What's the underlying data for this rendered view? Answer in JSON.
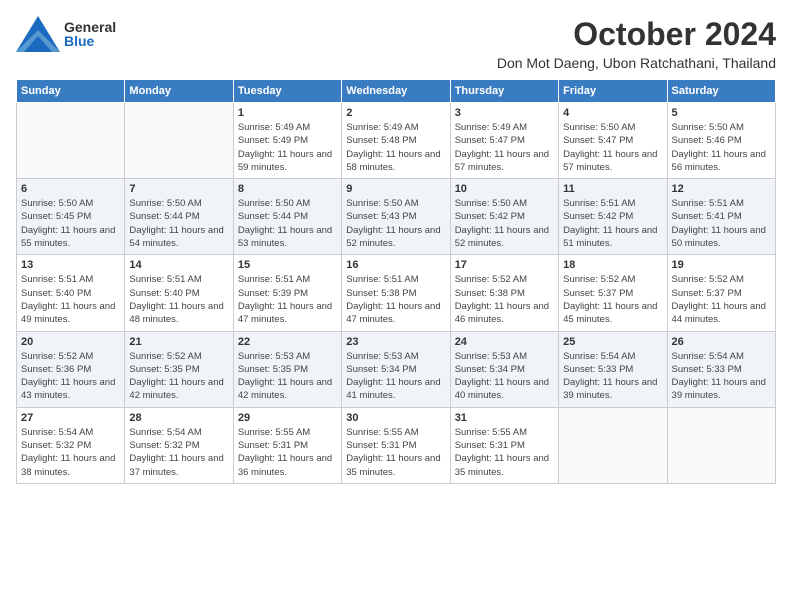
{
  "header": {
    "logo": {
      "general": "General",
      "blue": "Blue"
    },
    "title": "October 2024",
    "location": "Don Mot Daeng, Ubon Ratchathani, Thailand"
  },
  "calendar": {
    "days_of_week": [
      "Sunday",
      "Monday",
      "Tuesday",
      "Wednesday",
      "Thursday",
      "Friday",
      "Saturday"
    ],
    "weeks": [
      [
        {
          "day": "",
          "info": ""
        },
        {
          "day": "",
          "info": ""
        },
        {
          "day": "1",
          "info": "Sunrise: 5:49 AM\nSunset: 5:49 PM\nDaylight: 11 hours and 59 minutes."
        },
        {
          "day": "2",
          "info": "Sunrise: 5:49 AM\nSunset: 5:48 PM\nDaylight: 11 hours and 58 minutes."
        },
        {
          "day": "3",
          "info": "Sunrise: 5:49 AM\nSunset: 5:47 PM\nDaylight: 11 hours and 57 minutes."
        },
        {
          "day": "4",
          "info": "Sunrise: 5:50 AM\nSunset: 5:47 PM\nDaylight: 11 hours and 57 minutes."
        },
        {
          "day": "5",
          "info": "Sunrise: 5:50 AM\nSunset: 5:46 PM\nDaylight: 11 hours and 56 minutes."
        }
      ],
      [
        {
          "day": "6",
          "info": "Sunrise: 5:50 AM\nSunset: 5:45 PM\nDaylight: 11 hours and 55 minutes."
        },
        {
          "day": "7",
          "info": "Sunrise: 5:50 AM\nSunset: 5:44 PM\nDaylight: 11 hours and 54 minutes."
        },
        {
          "day": "8",
          "info": "Sunrise: 5:50 AM\nSunset: 5:44 PM\nDaylight: 11 hours and 53 minutes."
        },
        {
          "day": "9",
          "info": "Sunrise: 5:50 AM\nSunset: 5:43 PM\nDaylight: 11 hours and 52 minutes."
        },
        {
          "day": "10",
          "info": "Sunrise: 5:50 AM\nSunset: 5:42 PM\nDaylight: 11 hours and 52 minutes."
        },
        {
          "day": "11",
          "info": "Sunrise: 5:51 AM\nSunset: 5:42 PM\nDaylight: 11 hours and 51 minutes."
        },
        {
          "day": "12",
          "info": "Sunrise: 5:51 AM\nSunset: 5:41 PM\nDaylight: 11 hours and 50 minutes."
        }
      ],
      [
        {
          "day": "13",
          "info": "Sunrise: 5:51 AM\nSunset: 5:40 PM\nDaylight: 11 hours and 49 minutes."
        },
        {
          "day": "14",
          "info": "Sunrise: 5:51 AM\nSunset: 5:40 PM\nDaylight: 11 hours and 48 minutes."
        },
        {
          "day": "15",
          "info": "Sunrise: 5:51 AM\nSunset: 5:39 PM\nDaylight: 11 hours and 47 minutes."
        },
        {
          "day": "16",
          "info": "Sunrise: 5:51 AM\nSunset: 5:38 PM\nDaylight: 11 hours and 47 minutes."
        },
        {
          "day": "17",
          "info": "Sunrise: 5:52 AM\nSunset: 5:38 PM\nDaylight: 11 hours and 46 minutes."
        },
        {
          "day": "18",
          "info": "Sunrise: 5:52 AM\nSunset: 5:37 PM\nDaylight: 11 hours and 45 minutes."
        },
        {
          "day": "19",
          "info": "Sunrise: 5:52 AM\nSunset: 5:37 PM\nDaylight: 11 hours and 44 minutes."
        }
      ],
      [
        {
          "day": "20",
          "info": "Sunrise: 5:52 AM\nSunset: 5:36 PM\nDaylight: 11 hours and 43 minutes."
        },
        {
          "day": "21",
          "info": "Sunrise: 5:52 AM\nSunset: 5:35 PM\nDaylight: 11 hours and 42 minutes."
        },
        {
          "day": "22",
          "info": "Sunrise: 5:53 AM\nSunset: 5:35 PM\nDaylight: 11 hours and 42 minutes."
        },
        {
          "day": "23",
          "info": "Sunrise: 5:53 AM\nSunset: 5:34 PM\nDaylight: 11 hours and 41 minutes."
        },
        {
          "day": "24",
          "info": "Sunrise: 5:53 AM\nSunset: 5:34 PM\nDaylight: 11 hours and 40 minutes."
        },
        {
          "day": "25",
          "info": "Sunrise: 5:54 AM\nSunset: 5:33 PM\nDaylight: 11 hours and 39 minutes."
        },
        {
          "day": "26",
          "info": "Sunrise: 5:54 AM\nSunset: 5:33 PM\nDaylight: 11 hours and 39 minutes."
        }
      ],
      [
        {
          "day": "27",
          "info": "Sunrise: 5:54 AM\nSunset: 5:32 PM\nDaylight: 11 hours and 38 minutes."
        },
        {
          "day": "28",
          "info": "Sunrise: 5:54 AM\nSunset: 5:32 PM\nDaylight: 11 hours and 37 minutes."
        },
        {
          "day": "29",
          "info": "Sunrise: 5:55 AM\nSunset: 5:31 PM\nDaylight: 11 hours and 36 minutes."
        },
        {
          "day": "30",
          "info": "Sunrise: 5:55 AM\nSunset: 5:31 PM\nDaylight: 11 hours and 35 minutes."
        },
        {
          "day": "31",
          "info": "Sunrise: 5:55 AM\nSunset: 5:31 PM\nDaylight: 11 hours and 35 minutes."
        },
        {
          "day": "",
          "info": ""
        },
        {
          "day": "",
          "info": ""
        }
      ]
    ]
  }
}
